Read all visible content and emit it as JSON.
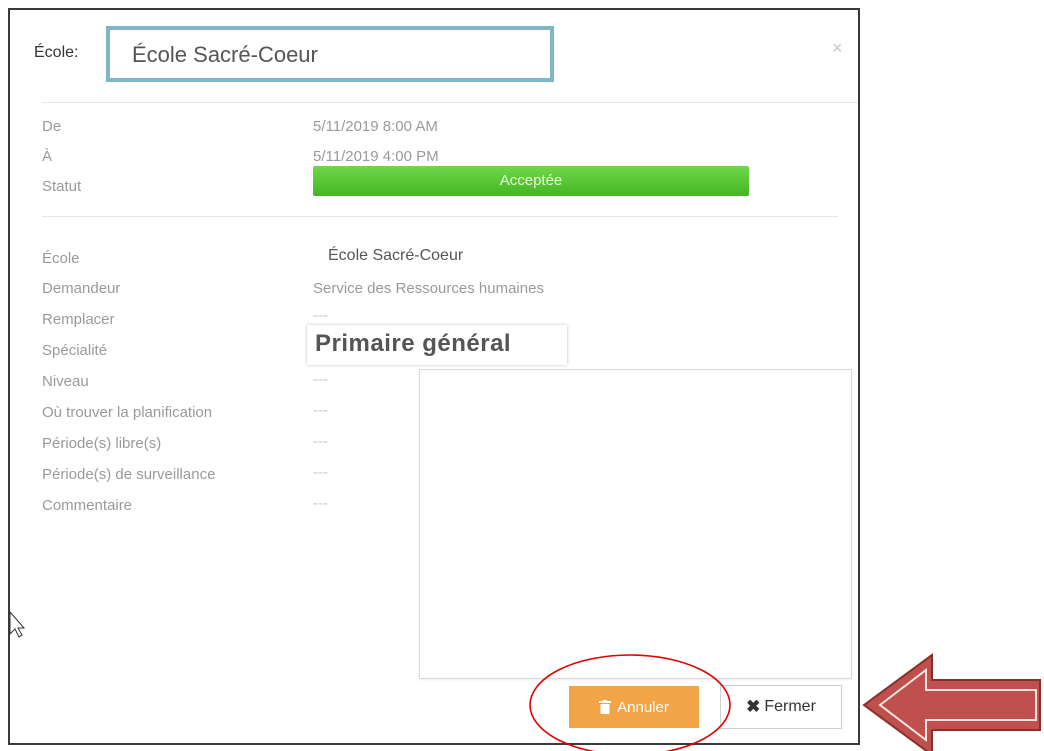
{
  "header": {
    "label": "École:",
    "school_value": "École Sacré-Coeur",
    "close_glyph": "×"
  },
  "schedule": {
    "from_label": "De",
    "from_value": "5/11/2019 8:00 AM",
    "to_label": "À",
    "to_value": "5/11/2019 4:00 PM",
    "status_label": "Statut",
    "status_value": "Acceptée",
    "status_color": "#4cbf2a"
  },
  "details": {
    "school_label": "École",
    "school_value": "École Sacré-Coeur",
    "requester_label": "Demandeur",
    "requester_value": "Service des Ressources humaines",
    "replace_label": "Remplacer",
    "replace_value": "---",
    "speciality_label": "Spécialité",
    "speciality_value": "Primaire général",
    "level_label": "Niveau",
    "level_value": "---",
    "planning_label": "Où trouver la planification",
    "planning_value": "---",
    "free_periods_label": "Période(s) libre(s)",
    "free_periods_value": "---",
    "supervision_label": "Période(s) de surveillance",
    "supervision_value": "---",
    "comment_label": "Commentaire",
    "comment_value": "---"
  },
  "footer": {
    "cancel_label": "Annuler",
    "cancel_color": "#f2a547",
    "close_label": "Fermer",
    "close_glyph": "✖"
  },
  "annotations": {
    "arrow_color": "#c0504d",
    "circle_color": "#e00000"
  }
}
